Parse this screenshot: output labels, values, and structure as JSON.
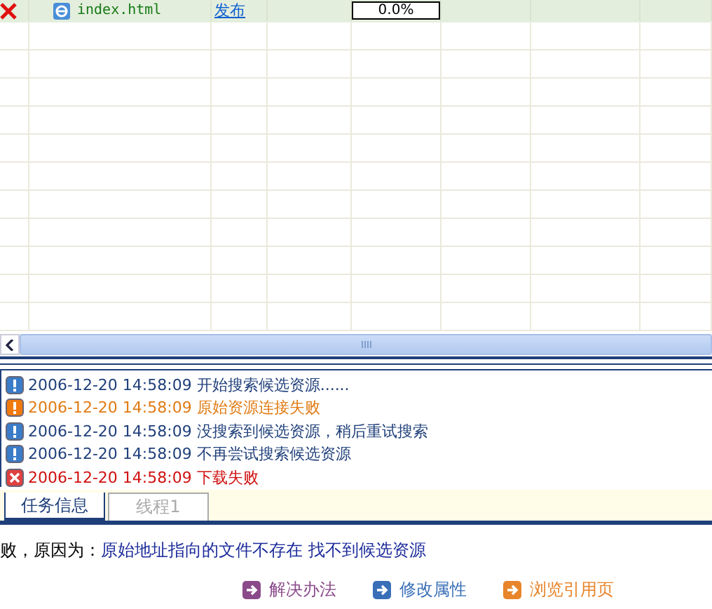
{
  "task_row": {
    "failed": true,
    "file_name": "index.html",
    "action": "发布",
    "progress_text": "0.0%",
    "level": 0
  },
  "log": [
    {
      "kind": "info",
      "time": "2006-12-20 14:58:09",
      "message": "开始搜索候选资源......"
    },
    {
      "kind": "warning",
      "time": "2006-12-20 14:58:09",
      "message": "原始资源连接失败"
    },
    {
      "kind": "info",
      "time": "2006-12-20 14:58:09",
      "message": "没搜索到候选资源，稍后重试搜索"
    },
    {
      "kind": "info",
      "time": "2006-12-20 14:58:09",
      "message": "不再尝试搜索候选资源"
    },
    {
      "kind": "error",
      "time": "2006-12-20 14:58:09",
      "message": "下载失败"
    }
  ],
  "tabs": [
    {
      "label": "任务信息",
      "selected": true
    },
    {
      "label": "线程1",
      "selected": false
    }
  ],
  "reason": {
    "label": "败，原因为：",
    "value": "原始地址指向的文件不存在 找不到候选资源"
  },
  "actions": [
    {
      "label": "解决办法",
      "color": "#8a4a8a"
    },
    {
      "label": "修改属性",
      "color": "#3a6fb8"
    },
    {
      "label": "浏览引用页",
      "color": "#e8842a"
    }
  ]
}
